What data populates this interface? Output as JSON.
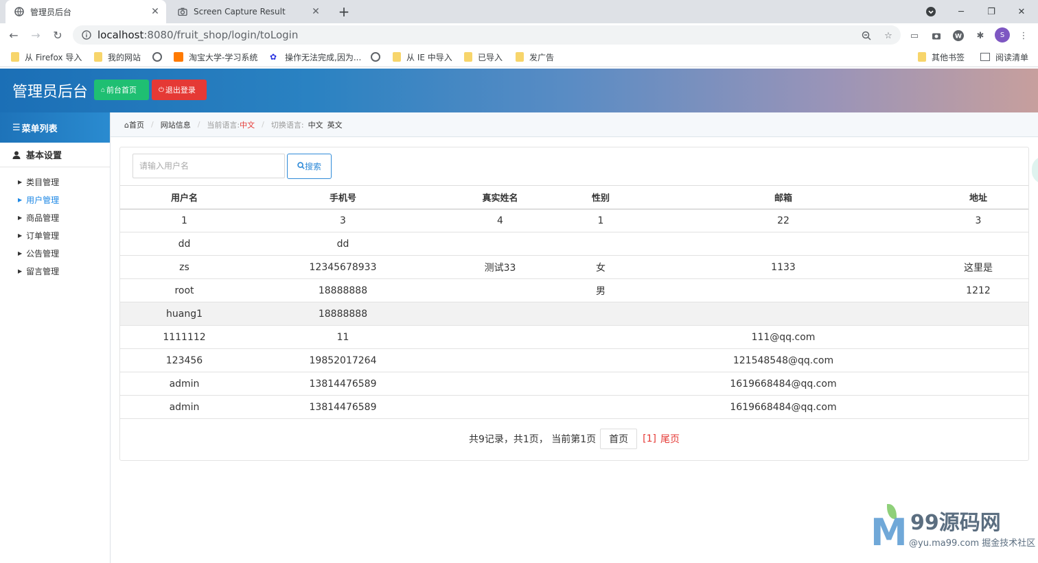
{
  "browser": {
    "tabs": [
      {
        "title": "管理员后台",
        "active": true
      },
      {
        "title": "Screen Capture Result",
        "active": false
      }
    ],
    "url_host": "localhost",
    "url_rest": ":8080/fruit_shop/login/toLogin",
    "profile_initial": "S",
    "bookmarks": [
      "从 Firefox 导入",
      "我的网站",
      "淘宝大学-学习系统",
      "操作无法完成,因为...",
      "从 IE 中导入",
      "已导入",
      "发广告"
    ],
    "bookmarks_right": [
      "其他书签",
      "阅读清单"
    ]
  },
  "header": {
    "title": "管理员后台",
    "home_button": "前台首页",
    "logout_button": "退出登录"
  },
  "sidebar": {
    "menu_title": "菜单列表",
    "section": "基本设置",
    "items": [
      "类目管理",
      "用户管理",
      "商品管理",
      "订单管理",
      "公告管理",
      "留言管理"
    ],
    "active_index": 1
  },
  "breadcrumb": {
    "home": "首页",
    "site_info": "网站信息",
    "current_lang_label": "当前语言:",
    "current_lang": "中文",
    "switch_label": "切换语言:",
    "lang_zh": "中文",
    "lang_en": "英文"
  },
  "search": {
    "placeholder": "请输入用户名",
    "button": "搜索"
  },
  "table": {
    "columns": [
      "用户名",
      "手机号",
      "真实姓名",
      "性别",
      "邮箱",
      "地址"
    ],
    "rows": [
      [
        "1",
        "3",
        "4",
        "1",
        "22",
        "3"
      ],
      [
        "dd",
        "dd",
        "",
        "",
        "",
        ""
      ],
      [
        "zs",
        "12345678933",
        "测试33",
        "女",
        "1133",
        "这里是"
      ],
      [
        "root",
        "18888888",
        "",
        "男",
        "",
        "1212"
      ],
      [
        "huang1",
        "18888888",
        "",
        "",
        "",
        ""
      ],
      [
        "1111112",
        "11",
        "",
        "",
        "111@qq.com",
        ""
      ],
      [
        "123456",
        "19852017264",
        "",
        "",
        "121548548@qq.com",
        ""
      ],
      [
        "admin",
        "13814476589",
        "",
        "",
        "1619668484@qq.com",
        ""
      ],
      [
        "admin",
        "13814476589",
        "",
        "",
        "1619668484@qq.com",
        ""
      ]
    ]
  },
  "pager": {
    "summary": "共9记录，共1页， 当前第1页",
    "first": "首页",
    "current": "[1]",
    "last": "尾页"
  },
  "watermark": {
    "brand": "99源码网",
    "sub": "@yu.ma99.com 掘金技术社区"
  },
  "colors": {
    "accent_blue": "#1e88e5",
    "green": "#1fbf72",
    "red": "#e53935"
  }
}
